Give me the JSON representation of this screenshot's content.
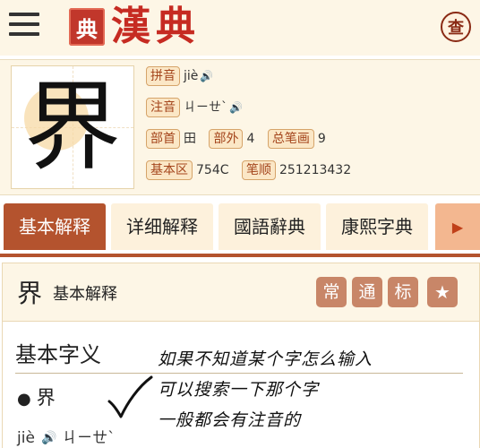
{
  "header": {
    "seal_text": "典",
    "logo_text": "漢典",
    "search_label": "查"
  },
  "character": {
    "glyph": "界",
    "fields": {
      "pinyin_label": "拼音",
      "pinyin_value": "jiè",
      "zhuyin_label": "注音",
      "zhuyin_value": "ㄐㄧㄝˋ",
      "radical_label": "部首",
      "radical_value": "田",
      "outer_strokes_label": "部外",
      "outer_strokes_value": "4",
      "total_strokes_label": "总笔画",
      "total_strokes_value": "9",
      "basic_block_label": "基本区",
      "basic_block_value": "754C",
      "stroke_order_label": "笔顺",
      "stroke_order_value": "251213432"
    }
  },
  "tabs": [
    {
      "label": "基本解释",
      "active": true
    },
    {
      "label": "详细解释",
      "active": false
    },
    {
      "label": "國語辭典",
      "active": false
    },
    {
      "label": "康熙字典",
      "active": false
    }
  ],
  "content": {
    "head_char": "界",
    "head_title": "基本解释",
    "badges": [
      "常",
      "通",
      "标"
    ],
    "section_title": "基本字义",
    "entry_char": "界",
    "entry_pinyin": "jiè",
    "entry_zhuyin": "ㄐㄧㄝˋ"
  },
  "annotation": {
    "lines": [
      "如果不知道某个字怎么输入",
      "可以搜索一下那个字",
      "一般都会有注音的"
    ]
  },
  "colors": {
    "accent": "#b4532e",
    "brand_red": "#c62b22",
    "tag_bg": "#fbe7c6",
    "badge_bg": "#c88668",
    "panel_bg": "#fdf6e6"
  },
  "icons": {
    "menu": "hamburger-icon",
    "search": "search-seal-icon",
    "speaker": "speaker-icon",
    "next": "chevron-right-icon",
    "star": "star-icon",
    "check": "checkmark-icon"
  }
}
